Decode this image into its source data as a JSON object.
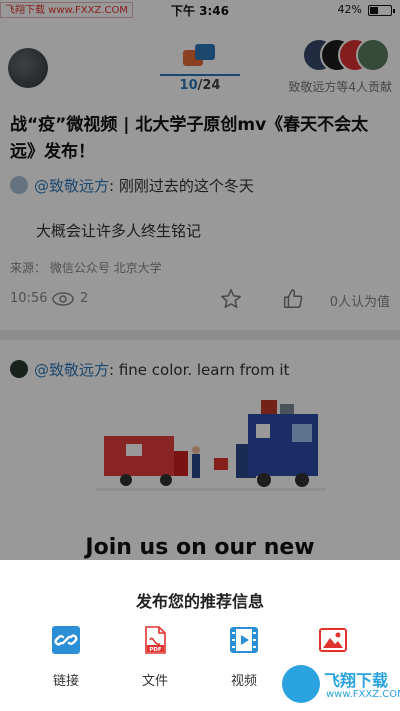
{
  "status": {
    "site_badge": "飞翔下载 www.FXXZ.COM",
    "time": "下午 3:46",
    "battery_pct": "42%",
    "battery_level": 0.42
  },
  "header": {
    "counter_current": "10",
    "counter_sep": "/",
    "counter_total": "24",
    "contributors_text": "致敬远方等4人贡献"
  },
  "post1": {
    "title": "战“疫”微视频 | 北大学子原创mv《春天不会太远》发布！",
    "author": "@致敬远方",
    "colon": ":",
    "quote": " 刚刚过去的这个冬天",
    "body": "大概会让许多人终生铭记",
    "source": "来源：  微信公众号 北京大学",
    "time": "10:56",
    "views": "2",
    "like_text": "0人认为值"
  },
  "post2": {
    "author": "@致敬远方",
    "colon": ":",
    "quote": " fine color. learn from it",
    "image_text": "Join us on our new"
  },
  "sheet": {
    "title": "发布您的推荐信息",
    "options": [
      {
        "label": "链接",
        "icon": "link-icon"
      },
      {
        "label": "文件",
        "icon": "pdf-file-icon"
      },
      {
        "label": "视频",
        "icon": "video-icon"
      },
      {
        "label": "",
        "icon": "image-icon"
      }
    ]
  },
  "watermark": {
    "title": "飞翔下载",
    "url": "www.FXXZ.COM"
  },
  "colors": {
    "accent": "#2f79b9",
    "pdf_red": "#e0332f",
    "video_blue": "#2a8fd6"
  }
}
